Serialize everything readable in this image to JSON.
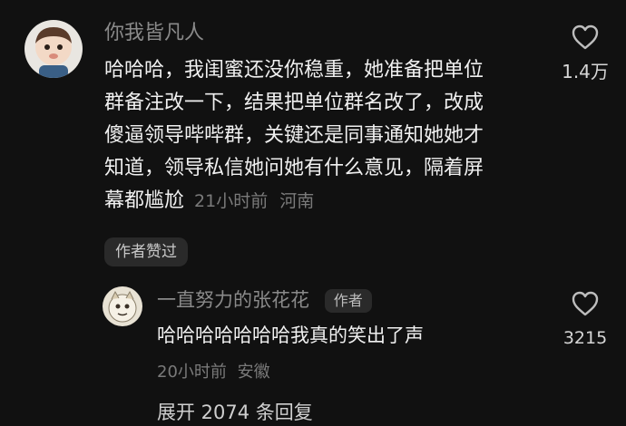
{
  "colors": {
    "background": "#111111",
    "username": "#8a8a8a",
    "text": "#f0f0f0",
    "meta": "#7a7a7a",
    "pill_bg": "#2a2a2a"
  },
  "comment": {
    "username": "你我皆凡人",
    "lines": [
      "哈哈哈，我闺蜜还没你稳重，她准备把单位",
      "群备注改一下，结果把单位群名改了，改成",
      "傻逼领导哔哔群，关键还是同事通知她她才",
      "知道，领导私信她问她有什么意见，隔着屏",
      "幕都尴尬"
    ],
    "time": "21小时前",
    "location": "河南",
    "like_icon": "heart-outline-icon",
    "like_count": "1.4万",
    "author_liked": "作者赞过"
  },
  "reply": {
    "username": "一直努力的张花花",
    "author_tag": "作者",
    "text": "哈哈哈哈哈哈哈我真的笑出了声",
    "time": "20小时前",
    "location": "安徽",
    "like_icon": "heart-outline-icon",
    "like_count": "3215"
  },
  "expand_replies": "展开 2074 条回复"
}
